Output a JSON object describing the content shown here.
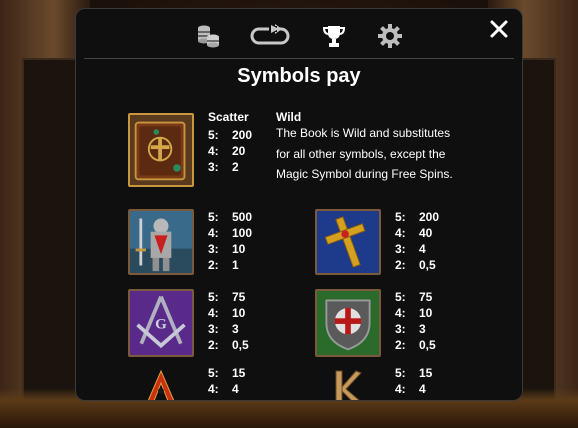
{
  "modal": {
    "title": "Symbols pay"
  },
  "toolbar": {
    "icons": [
      "coins-icon",
      "autoplay-loop-icon",
      "trophy-icon",
      "gear-icon"
    ],
    "active": "trophy-icon",
    "close": "close-icon"
  },
  "scatter_wild": {
    "scatter_header": "Scatter",
    "wild_header": "Wild",
    "pays": [
      {
        "k": "5:",
        "v": "200"
      },
      {
        "k": "4:",
        "v": "20"
      },
      {
        "k": "3:",
        "v": "2"
      }
    ],
    "description": "The Book is Wild and substitutes for all other symbols, except the Magic Symbol during Free Spins."
  },
  "symbols": {
    "knight": [
      {
        "k": "5:",
        "v": "500"
      },
      {
        "k": "4:",
        "v": "100"
      },
      {
        "k": "3:",
        "v": "10"
      },
      {
        "k": "2:",
        "v": "1"
      }
    ],
    "cross": [
      {
        "k": "5:",
        "v": "200"
      },
      {
        "k": "4:",
        "v": "40"
      },
      {
        "k": "3:",
        "v": "4"
      },
      {
        "k": "2:",
        "v": "0,5"
      }
    ],
    "compass": [
      {
        "k": "5:",
        "v": "75"
      },
      {
        "k": "4:",
        "v": "10"
      },
      {
        "k": "3:",
        "v": "3"
      },
      {
        "k": "2:",
        "v": "0,5"
      }
    ],
    "shield": [
      {
        "k": "5:",
        "v": "75"
      },
      {
        "k": "4:",
        "v": "10"
      },
      {
        "k": "3:",
        "v": "3"
      },
      {
        "k": "2:",
        "v": "0,5"
      }
    ],
    "ace": [
      {
        "k": "5:",
        "v": "15"
      },
      {
        "k": "4:",
        "v": "4"
      }
    ],
    "king": [
      {
        "k": "5:",
        "v": "15"
      },
      {
        "k": "4:",
        "v": "4"
      }
    ]
  },
  "colors": {
    "modal_bg": "#0f0f10",
    "text": "#ffffff",
    "icon": "#c8c8c8",
    "active_icon": "#ffffff"
  }
}
